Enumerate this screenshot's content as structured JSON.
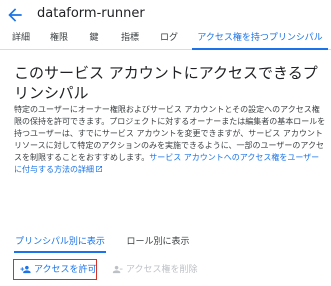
{
  "header": {
    "title": "dataform-runner"
  },
  "tabs": [
    {
      "label": "詳細"
    },
    {
      "label": "権限"
    },
    {
      "label": "鍵"
    },
    {
      "label": "指標"
    },
    {
      "label": "ログ"
    },
    {
      "label": "アクセス権を持つプリンシパル",
      "active": true
    }
  ],
  "main": {
    "heading": "このサービス アカウントにアクセスできるプリンシパル",
    "description": "特定のユーザーにオーナー権限およびサービス アカウントとその設定へのアクセス権限の保持を許可できます。プロジェクトに対するオーナーまたは編集者の基本ロールを持つユーザーは、すでにサービス アカウントを変更できますが、サービス アカウント リソースに対して特定のアクションのみを実施できるように、一部のユーザーのアクセスを制限することをおすすめします。",
    "link_text": "サービス アカウントへのアクセス権をユーザーに付与する方法の詳細"
  },
  "view_tabs": [
    {
      "label": "プリンシパル別に表示",
      "active": true
    },
    {
      "label": "ロール別に表示",
      "active": false
    }
  ],
  "actions": {
    "grant_label": "アクセスを許可",
    "remove_label": "アクセス権を削除"
  },
  "colors": {
    "accent": "#1a73e8",
    "highlight_border": "#d93025",
    "disabled": "#bdc1c6"
  }
}
